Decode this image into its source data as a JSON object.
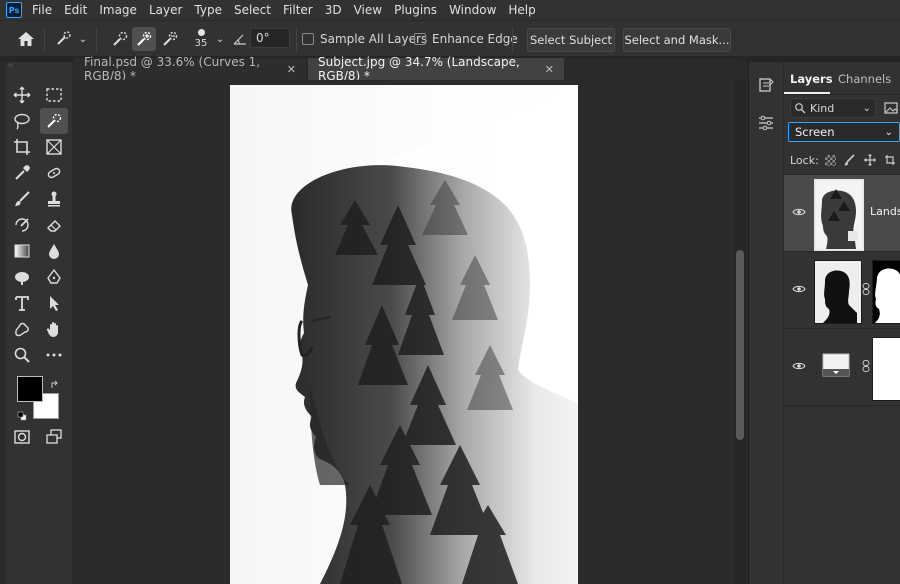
{
  "menu": {
    "logo": "Ps",
    "items": [
      "File",
      "Edit",
      "Image",
      "Layer",
      "Type",
      "Select",
      "Filter",
      "3D",
      "View",
      "Plugins",
      "Window",
      "Help"
    ]
  },
  "options": {
    "brush_size": "35",
    "angle": "0°",
    "sample_all_layers": "Sample All Layers",
    "enhance_edge": "Enhance Edge",
    "select_subject": "Select Subject",
    "select_and_mask": "Select and Mask..."
  },
  "tabs": [
    {
      "label": "Final.psd @ 33.6% (Curves 1, RGB/8) *",
      "active": false
    },
    {
      "label": "Subject.jpg @ 34.7% (Landscape, RGB/8) *",
      "active": true
    }
  ],
  "panel": {
    "tab_layers": "Layers",
    "tab_channels": "Channels",
    "filter_kind": "Kind",
    "blend_mode": "Screen",
    "lock_label": "Lock:",
    "layers": [
      {
        "name": "Landsc"
      },
      {
        "name": ""
      },
      {
        "name": ""
      }
    ]
  },
  "colors": {
    "accent": "#31a8ff",
    "foreground": "#000000",
    "background": "#ffffff"
  }
}
